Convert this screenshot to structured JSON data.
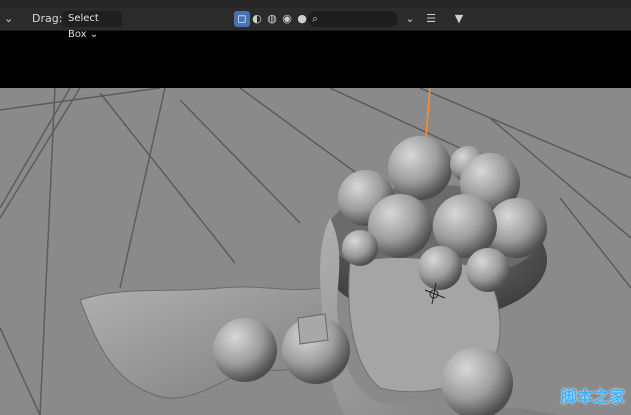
{
  "toolbar": {
    "drag_label": "Drag:",
    "drag_mode": "Select Box"
  },
  "watermark": "脚本之家",
  "colors": {
    "header_bg": "#2b2b2b",
    "active_blue": "#4772b3",
    "floor": "#8a8a8a",
    "apple": "#9c9c9c",
    "origin_line": "#ff8c2a"
  }
}
